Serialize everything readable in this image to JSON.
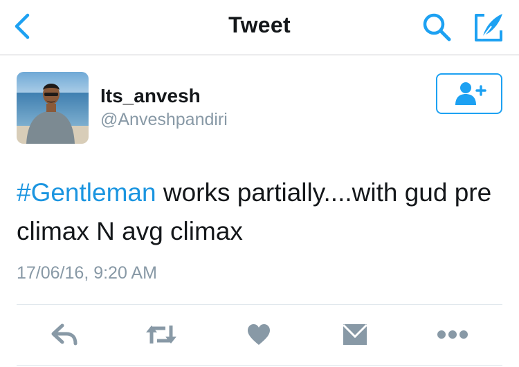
{
  "nav": {
    "title": "Tweet",
    "back_icon": "chevron-left-icon",
    "search_icon": "search-icon",
    "compose_icon": "compose-icon",
    "accent_color": "#1da1f2"
  },
  "author": {
    "name": "Its_anvesh",
    "handle": "@Anveshpandiri",
    "follow_icon": "add-user-icon"
  },
  "tweet": {
    "hashtag": "#Gentleman",
    "text": " works partially....with gud pre climax N avg climax",
    "timestamp": "17/06/16, 9:20 AM"
  },
  "actions": [
    {
      "name": "reply",
      "icon": "reply-icon"
    },
    {
      "name": "retweet",
      "icon": "retweet-icon"
    },
    {
      "name": "like",
      "icon": "heart-icon"
    },
    {
      "name": "direct-message",
      "icon": "envelope-icon"
    },
    {
      "name": "more",
      "icon": "more-icon"
    }
  ],
  "colors": {
    "icon_gray": "#8899a6",
    "hashtag": "#1b95e0",
    "text": "#14171a"
  }
}
